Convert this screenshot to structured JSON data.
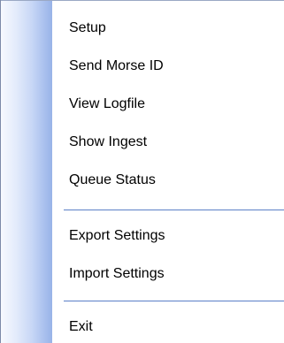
{
  "menu": {
    "groups": [
      {
        "items": [
          {
            "label": "Setup"
          },
          {
            "label": "Send Morse ID"
          },
          {
            "label": "View Logfile"
          },
          {
            "label": "Show Ingest"
          },
          {
            "label": "Queue Status"
          }
        ]
      },
      {
        "items": [
          {
            "label": "Export Settings"
          },
          {
            "label": "Import Settings"
          }
        ]
      },
      {
        "items": [
          {
            "label": "Exit"
          }
        ]
      }
    ]
  }
}
